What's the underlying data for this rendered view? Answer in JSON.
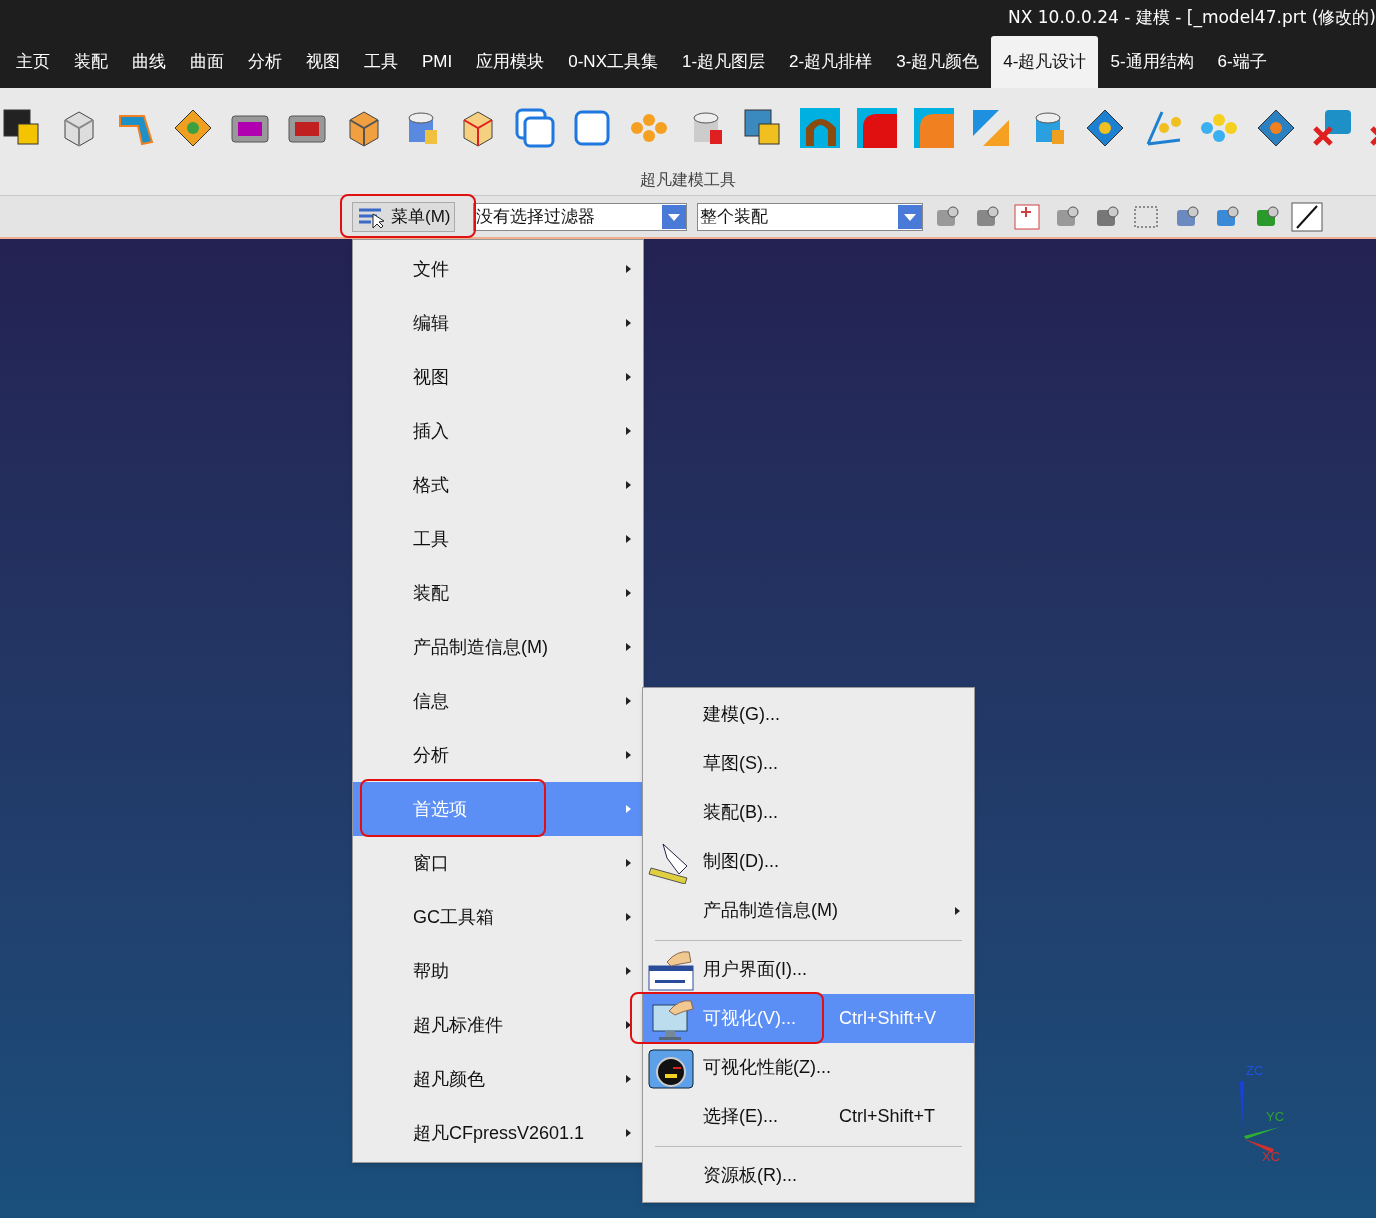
{
  "window": {
    "title": "NX 10.0.0.24 - 建模 - [_model47.prt  (修改的)"
  },
  "tabs": [
    {
      "label": "主页",
      "selected": false
    },
    {
      "label": "装配",
      "selected": false
    },
    {
      "label": "曲线",
      "selected": false
    },
    {
      "label": "曲面",
      "selected": false
    },
    {
      "label": "分析",
      "selected": false
    },
    {
      "label": "视图",
      "selected": false
    },
    {
      "label": "工具",
      "selected": false
    },
    {
      "label": "PMI",
      "selected": false
    },
    {
      "label": "应用模块",
      "selected": false
    },
    {
      "label": "0-NX工具集",
      "selected": false
    },
    {
      "label": "1-超凡图层",
      "selected": false
    },
    {
      "label": "2-超凡排样",
      "selected": false
    },
    {
      "label": "3-超凡颜色",
      "selected": false
    },
    {
      "label": "4-超凡设计",
      "selected": true
    },
    {
      "label": "5-通用结构",
      "selected": false
    },
    {
      "label": "6-端子",
      "selected": false
    }
  ],
  "ribbon": {
    "group_label": "超凡建模工具"
  },
  "toolbar": {
    "menu_button": "菜单(M)",
    "filter_dropdown": "没有选择过滤器",
    "scope_dropdown": "整个装配"
  },
  "main_menu": [
    {
      "label": "文件",
      "selected": false
    },
    {
      "label": "编辑",
      "selected": false
    },
    {
      "label": "视图",
      "selected": false
    },
    {
      "label": "插入",
      "selected": false
    },
    {
      "label": "格式",
      "selected": false
    },
    {
      "label": "工具",
      "selected": false
    },
    {
      "label": "装配",
      "selected": false
    },
    {
      "label": "产品制造信息(M)",
      "selected": false
    },
    {
      "label": "信息",
      "selected": false
    },
    {
      "label": "分析",
      "selected": false
    },
    {
      "label": "首选项",
      "selected": true
    },
    {
      "label": "窗口",
      "selected": false
    },
    {
      "label": "GC工具箱",
      "selected": false
    },
    {
      "label": "帮助",
      "selected": false
    },
    {
      "label": "超凡标准件",
      "selected": false
    },
    {
      "label": "超凡颜色",
      "selected": false
    },
    {
      "label": "超凡CFpressV2601.1",
      "selected": false
    }
  ],
  "submenu": [
    {
      "kind": "item",
      "label": "建模(G)...",
      "selected": false
    },
    {
      "kind": "item",
      "label": "草图(S)...",
      "selected": false
    },
    {
      "kind": "item",
      "label": "装配(B)...",
      "selected": false
    },
    {
      "kind": "item",
      "label": "制图(D)...",
      "selected": false
    },
    {
      "kind": "submenu",
      "label": "产品制造信息(M)",
      "selected": false
    },
    {
      "kind": "separator"
    },
    {
      "kind": "item",
      "label": "用户界面(I)...",
      "selected": false
    },
    {
      "kind": "item",
      "label": "可视化(V)...",
      "shortcut": "Ctrl+Shift+V",
      "selected": true
    },
    {
      "kind": "item",
      "label": "可视化性能(Z)...",
      "selected": false
    },
    {
      "kind": "item",
      "label": "选择(E)...",
      "shortcut": "Ctrl+Shift+T",
      "selected": false
    },
    {
      "kind": "separator"
    },
    {
      "kind": "item",
      "label": "资源板(R)...",
      "selected": false
    }
  ],
  "triad": {
    "z": "ZC",
    "y": "YC",
    "x": "XC"
  }
}
